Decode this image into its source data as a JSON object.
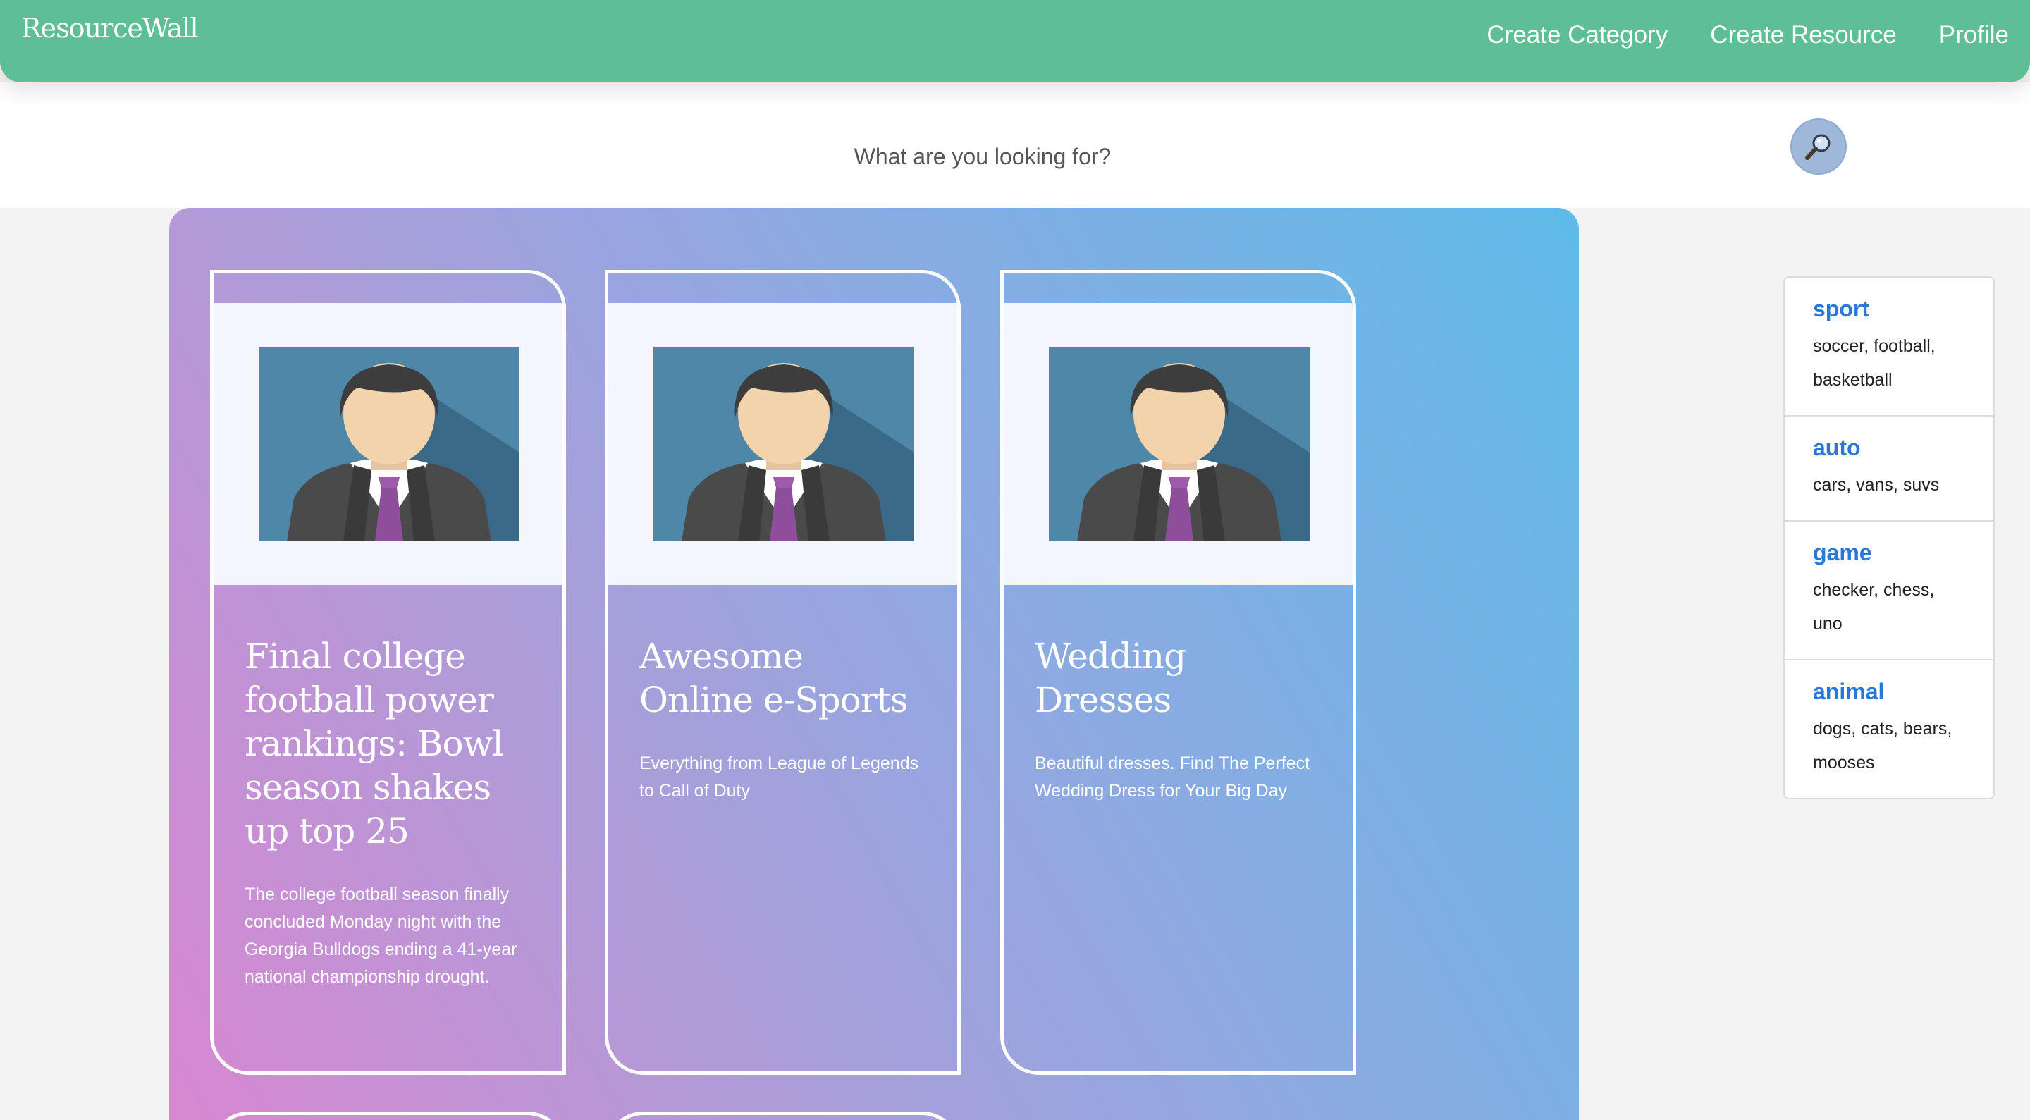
{
  "navbar": {
    "brand": "ResourceWall",
    "links": [
      "Create Category",
      "Create Resource",
      "Profile"
    ],
    "color": "#5dbf93"
  },
  "search": {
    "placeholder": "What are you looking for?",
    "button_icon": "magnifier-icon"
  },
  "resources": [
    {
      "image": "businessman-avatar",
      "title": "Final college football power rankings: Bowl season shakes up top 25",
      "description": "The college football season finally concluded Monday night with the Georgia Bulldogs ending a 41-year national championship drought."
    },
    {
      "image": "businessman-avatar",
      "title": "Awesome Online e-Sports",
      "description": "Everything from League of Legends to Call of Duty"
    },
    {
      "image": "businessman-avatar",
      "title": "Wedding Dresses",
      "description": "Beautiful dresses. Find The Perfect Wedding Dress for Your Big Day"
    }
  ],
  "categories": [
    {
      "name": "sport",
      "tags": "soccer, football, basketball"
    },
    {
      "name": "auto",
      "tags": "cars, vans, suvs"
    },
    {
      "name": "game",
      "tags": "checker, chess, uno"
    },
    {
      "name": "animal",
      "tags": "dogs, cats, bears, mooses"
    }
  ],
  "colors": {
    "panel_gradient": [
      "#d887d1",
      "#a99ed9",
      "#8caae2",
      "#5fbbe8"
    ],
    "category_link": "#2a78d6"
  }
}
